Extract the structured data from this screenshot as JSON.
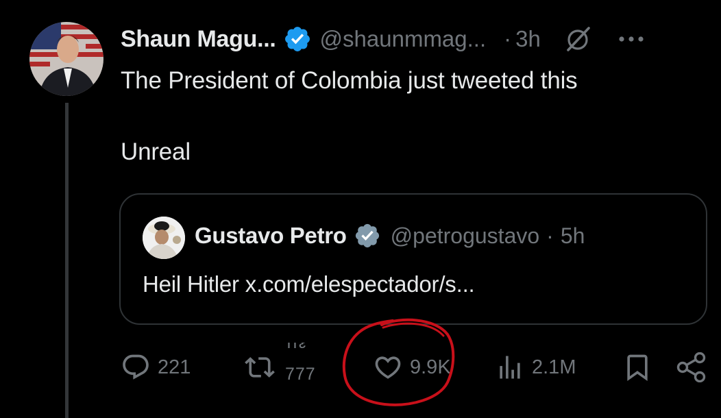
{
  "post": {
    "author_name": "Shaun Magu...",
    "author_handle": "@shaunmmag...",
    "separator": "·",
    "time": "3h",
    "text": "The President of Colombia just tweeted this\n\nUnreal",
    "verified_color": "#1d9bf0",
    "icons": [
      "verified-badge-icon",
      "grok-icon",
      "more-icon"
    ]
  },
  "quote": {
    "author_name": "Gustavo Petro",
    "author_handle": "@petrogustavo",
    "separator": "·",
    "time": "5h",
    "text": "Heil Hitler x.com/elespectador/s...",
    "verified_color": "#829aab"
  },
  "actions": {
    "reply_count": "221",
    "repost_count_top": "ııᴤ",
    "repost_count_bottom": "777",
    "like_count": "9.9K",
    "views_count": "2.1M",
    "icons": [
      "reply-icon",
      "repost-icon",
      "like-icon",
      "views-icon",
      "bookmark-icon",
      "share-icon"
    ]
  },
  "colors": {
    "background": "#000000",
    "text_primary": "#e7e9ea",
    "text_secondary": "#71767b",
    "border": "#2f3336",
    "annotation_circle": "#c8101a"
  }
}
